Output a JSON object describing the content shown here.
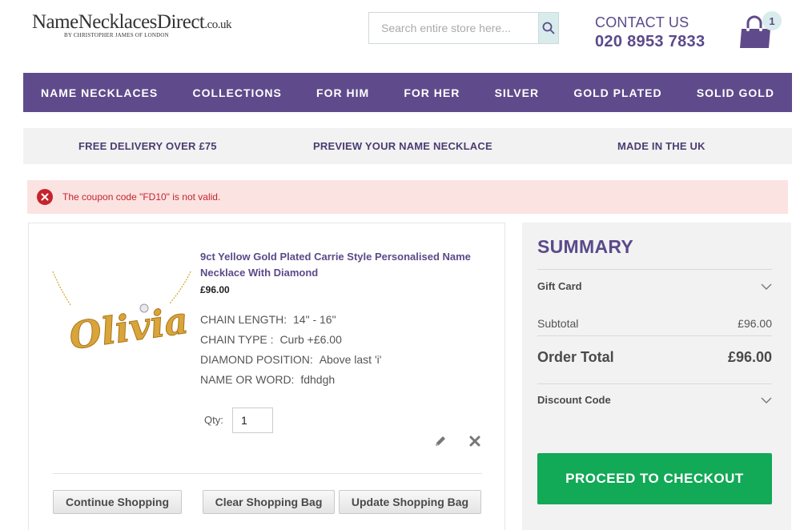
{
  "header": {
    "logo": {
      "part1": "NameNecklaces",
      "part2": "Direct",
      "part3": ".co.uk",
      "tagline": "BY CHRISTOPHER JAMES OF LONDON"
    },
    "search": {
      "placeholder": "Search entire store here...",
      "icon": "search-icon"
    },
    "contact": {
      "label": "CONTACT US",
      "phone": "020 8953 7833"
    },
    "cart": {
      "icon": "shopping-bag-icon",
      "count": "1"
    }
  },
  "nav": {
    "items": [
      "NAME NECKLACES",
      "COLLECTIONS",
      "FOR HIM",
      "FOR HER",
      "SILVER",
      "GOLD PLATED",
      "SOLID GOLD"
    ]
  },
  "benefits": [
    "FREE DELIVERY OVER £75",
    "PREVIEW YOUR NAME NECKLACE",
    "MADE IN THE UK"
  ],
  "error": {
    "message": "The coupon code \"FD10\" is not valid.",
    "icon": "close-icon"
  },
  "cart": {
    "item": {
      "name": "9ct Yellow Gold Plated Carrie Style Personalised Name Necklace With Diamond",
      "price": "£96.00",
      "image_text": "Olivia",
      "options": [
        {
          "label": "CHAIN LENGTH:",
          "value": "14\" - 16\""
        },
        {
          "label": "CHAIN TYPE :",
          "value": "Curb +£6.00"
        },
        {
          "label": "DIAMOND POSITION:",
          "value": "Above last 'i'"
        },
        {
          "label": "NAME OR WORD:",
          "value": "fdhdgh"
        }
      ],
      "qty_label": "Qty:",
      "qty_value": "1"
    },
    "buttons": {
      "continue": "Continue Shopping",
      "clear": "Clear Shopping Bag",
      "update": "Update Shopping Bag"
    }
  },
  "summary": {
    "title": "SUMMARY",
    "gift_card": "Gift Card",
    "subtotal_label": "Subtotal",
    "subtotal_value": "£96.00",
    "total_label": "Order Total",
    "total_value": "£96.00",
    "discount_label": "Discount Code",
    "checkout": "PROCEED TO CHECKOUT"
  },
  "colors": {
    "brand_purple": "#5f4b8b",
    "checkout_green": "#12a957",
    "error_red": "#c5242c",
    "error_bg": "#fbe3e2"
  }
}
